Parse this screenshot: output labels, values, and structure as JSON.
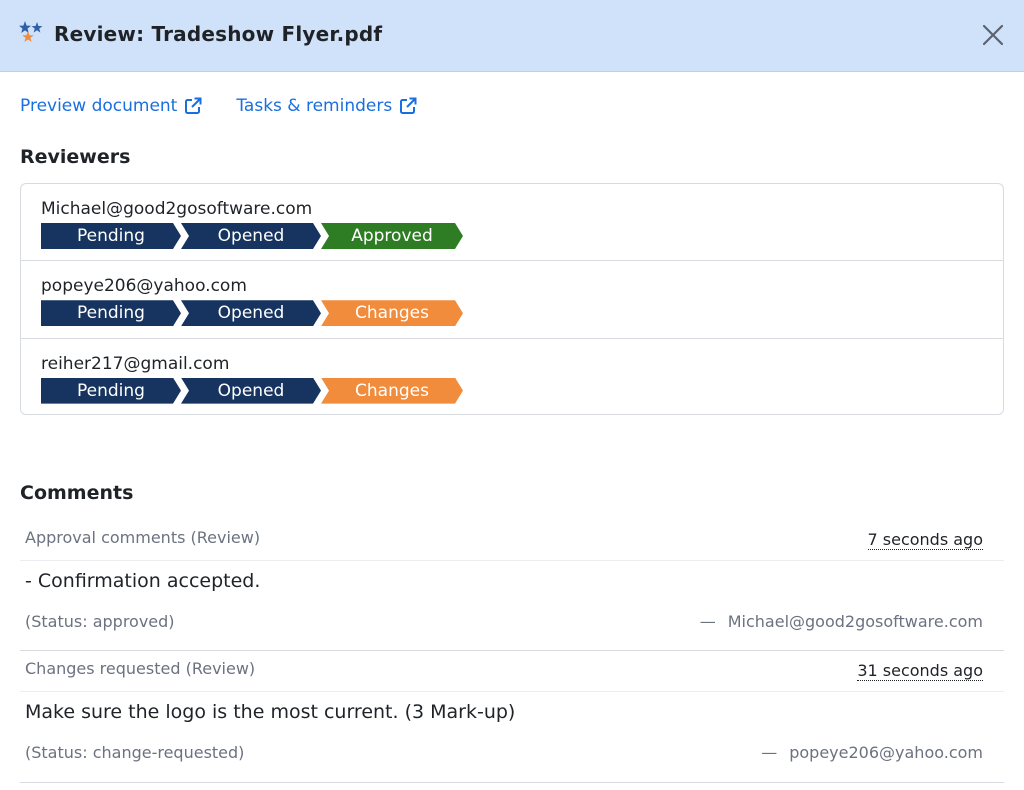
{
  "header": {
    "title": "Review: Tradeshow Flyer.pdf",
    "icon": "stars-icon",
    "close_icon": "close-icon",
    "background": "#cfe2f9"
  },
  "links": {
    "preview": "Preview document",
    "tasks": "Tasks & reminders",
    "icon": "external-link-icon",
    "color": "#1a6fe0"
  },
  "reviewers": {
    "title": "Reviewers",
    "rows": [
      {
        "email": "Michael@good2gosoftware.com",
        "steps": [
          {
            "label": "Pending",
            "color": "#16345f"
          },
          {
            "label": "Opened",
            "color": "#16345f"
          },
          {
            "label": "Approved",
            "color": "#2e7d24"
          }
        ]
      },
      {
        "email": "popeye206@yahoo.com",
        "steps": [
          {
            "label": "Pending",
            "color": "#16345f"
          },
          {
            "label": "Opened",
            "color": "#16345f"
          },
          {
            "label": "Changes",
            "color": "#f08c3c"
          }
        ]
      },
      {
        "email": "reiher217@gmail.com",
        "steps": [
          {
            "label": "Pending",
            "color": "#16345f"
          },
          {
            "label": "Opened",
            "color": "#16345f"
          },
          {
            "label": "Changes",
            "color": "#f08c3c"
          }
        ]
      }
    ]
  },
  "comments": {
    "title": "Comments",
    "items": [
      {
        "heading": "Approval comments (Review)",
        "time": "7 seconds ago",
        "body": "- Confirmation accepted.",
        "status": "(Status: approved)",
        "dash": "—",
        "author": "Michael@good2gosoftware.com"
      },
      {
        "heading": "Changes requested (Review)",
        "time": "31 seconds ago",
        "body": "Make sure the logo is the most current. (3 Mark-up)",
        "status": "(Status: change-requested)",
        "dash": "—",
        "author": "popeye206@yahoo.com"
      }
    ]
  }
}
